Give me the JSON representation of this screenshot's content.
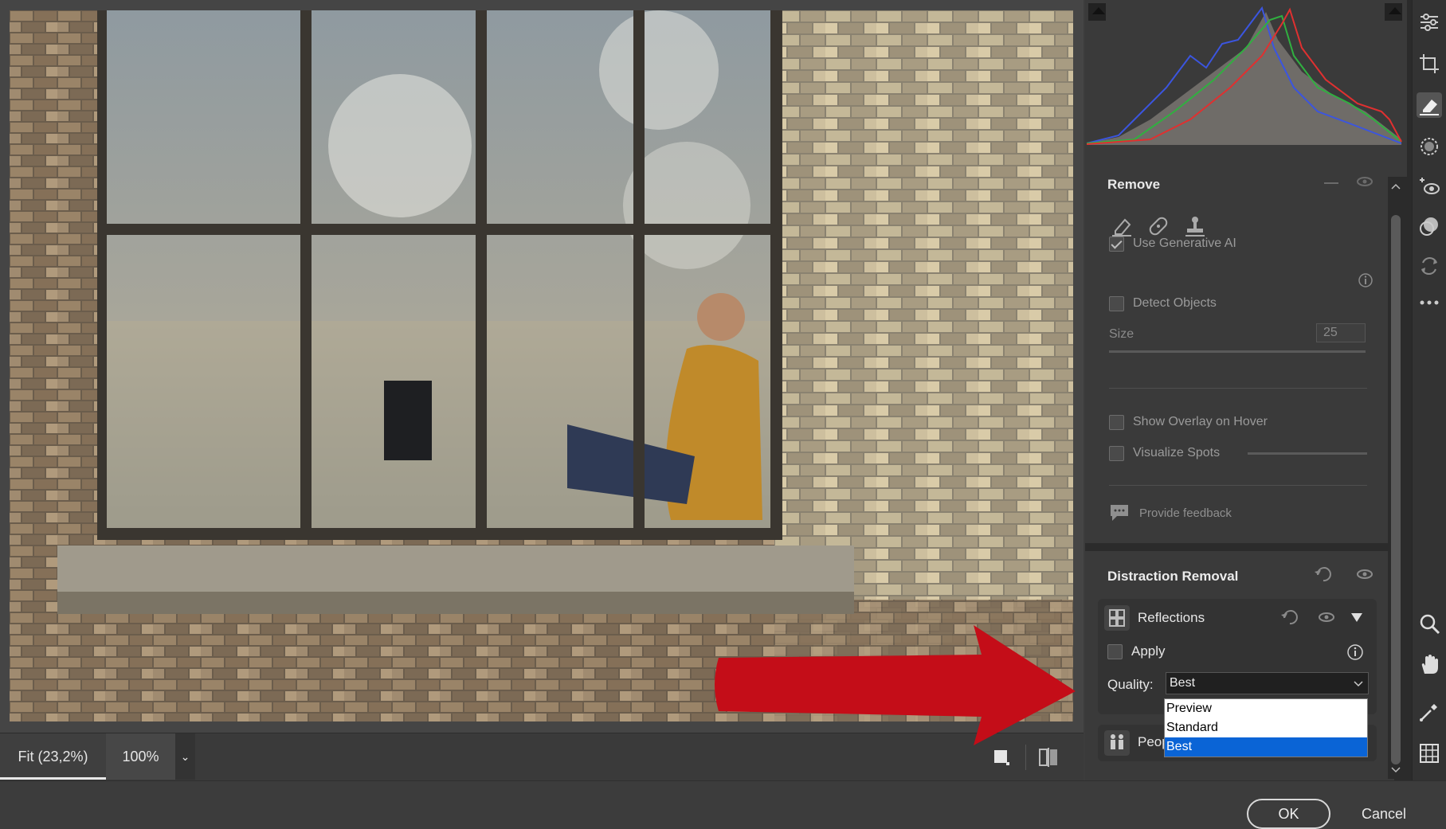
{
  "zoom": {
    "fit_label": "Fit (23,2%)",
    "hundred_label": "100%",
    "dropdown_glyph": "⌄"
  },
  "remove_panel": {
    "title": "Remove",
    "use_generative_ai": {
      "label": "Use Generative AI",
      "checked": true
    },
    "detect_objects": {
      "label": "Detect Objects",
      "checked": false
    },
    "size_label": "Size",
    "size_value": "25",
    "show_overlay": {
      "label": "Show Overlay on Hover",
      "checked": false
    },
    "visualize_spots": {
      "label": "Visualize Spots",
      "checked": false
    },
    "feedback_label": "Provide feedback"
  },
  "distraction_panel": {
    "title": "Distraction Removal",
    "reflections_label": "Reflections",
    "apply_label": "Apply",
    "quality_label": "Quality:",
    "quality_value": "Best",
    "quality_options": [
      "Preview",
      "Standard",
      "Best"
    ],
    "people_label": "Peop"
  },
  "footer": {
    "ok_label": "OK",
    "cancel_label": "Cancel"
  },
  "icons": {
    "tools": [
      "edit-sliders-icon",
      "crop-icon",
      "remove-eraser-icon",
      "masking-icon",
      "red-eye-icon",
      "presets-icon",
      "snapshots-icon",
      "more-icon",
      "zoom-icon",
      "hand-icon",
      "color-sampler-icon",
      "grid-icon"
    ]
  },
  "colors": {
    "accent_blue": "#0a64d6",
    "annotation_red": "#c40d18"
  }
}
